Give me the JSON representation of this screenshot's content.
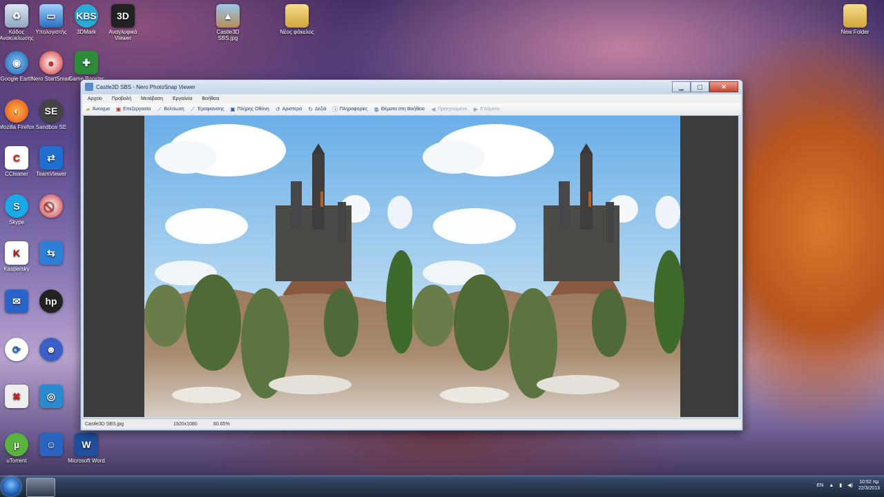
{
  "window": {
    "title": "Castle3D SBS - Nero PhotoSnap Viewer",
    "menu": [
      "Αρχείο",
      "Προβολή",
      "Μετάβαση",
      "Εργαλεία",
      "Βοήθεια"
    ],
    "toolbar": {
      "open": "Άνοιγμα",
      "edit": "Επεξεργασία",
      "optimize": "Βελτίωση",
      "redeye": "Έραφιανσης",
      "fullscreen": "Πλήρης Οθόνη",
      "rotate_left": "Αριστερά",
      "rotate_right": "Δεξιά",
      "info": "Πληροφορίες",
      "help": "Θέματα στη Βοήθεια",
      "previous": "Προηγούμενο",
      "next": "Επόμενο"
    },
    "status": {
      "filename": "Castle3D SBS.jpg",
      "dimensions": "1920x1080",
      "zoom": "60.65%"
    }
  },
  "desktop_icons": [
    {
      "label": "Κάδος Ανακύκλωσης",
      "icon": "recycle-bin-icon"
    },
    {
      "label": "Υπολογιστής",
      "icon": "computer-icon"
    },
    {
      "label": "3DMark",
      "icon": "3d-app-icon"
    },
    {
      "label": "Αναγλυφικά Viewer",
      "icon": "3d-viewer-icon"
    },
    {
      "label": "Castle3D SBS.jpg",
      "icon": "image-file-icon"
    },
    {
      "label": "Νέος φάκελος",
      "icon": "folder-icon"
    },
    {
      "label": "New Folder",
      "icon": "folder-icon"
    },
    {
      "label": "Google Earth",
      "icon": "google-earth-icon"
    },
    {
      "label": "Nero StartSmart",
      "icon": "nero-icon"
    },
    {
      "label": "Game Booster",
      "icon": "game-icon"
    },
    {
      "label": "Mozilla Firefox",
      "icon": "firefox-icon"
    },
    {
      "label": "Sandbox SE",
      "icon": "se-icon"
    },
    {
      "label": "CCleaner",
      "icon": "ccleaner-icon"
    },
    {
      "label": "TeamViewer",
      "icon": "teamviewer-icon"
    },
    {
      "label": "Skype",
      "icon": "skype-icon"
    },
    {
      "label": "Kaspersky",
      "icon": "kaspersky-icon"
    },
    {
      "label": "uTorrent",
      "icon": "utorrent-icon"
    },
    {
      "label": "Microsoft Word",
      "icon": "word-icon"
    }
  ],
  "taskbar": {
    "language": "EN",
    "time": "10:52 πμ",
    "date": "22/3/2013"
  },
  "colors": {
    "window_frame": "#cfdcec",
    "viewer_bg": "#3c3c3c",
    "taskbar": "#1c2739"
  }
}
